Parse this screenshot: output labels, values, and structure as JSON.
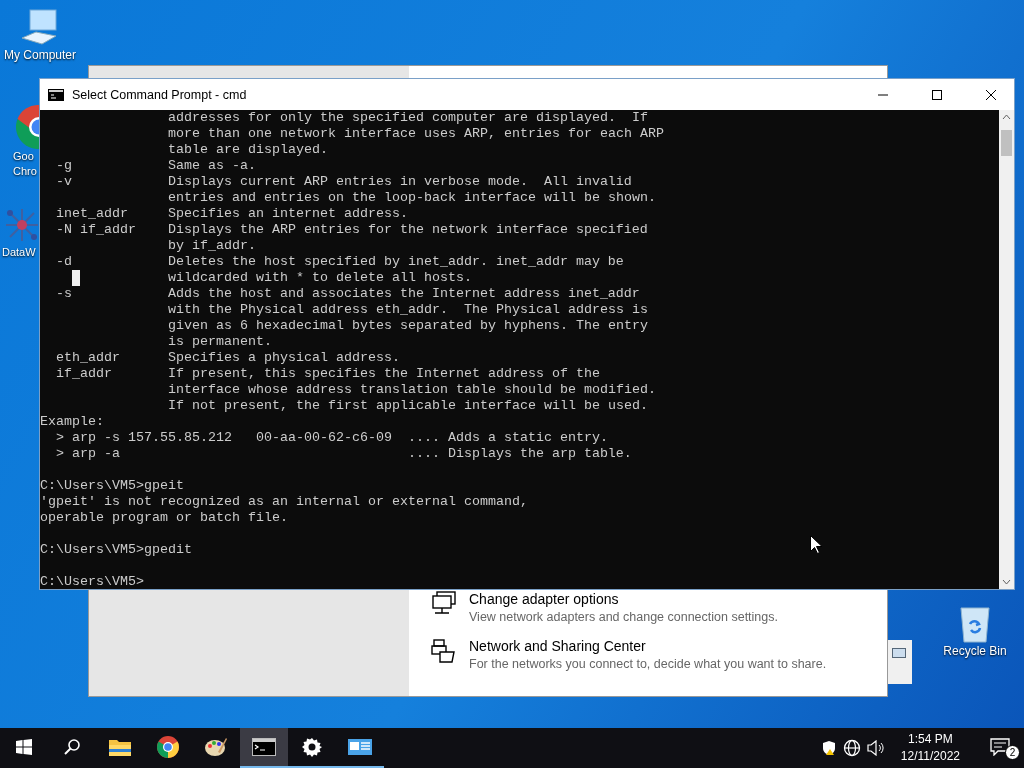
{
  "desktop_icons": [
    {
      "kind": "computer",
      "label": [
        "My Computer"
      ]
    },
    {
      "kind": "chrome",
      "label": [
        "Goo",
        "Chro"
      ]
    },
    {
      "kind": "molecule",
      "label": [
        "DataW"
      ]
    }
  ],
  "recycle_bin": {
    "label": "Recycle Bin"
  },
  "settings_window": {
    "items": [
      {
        "kind": "adapter",
        "title": "Change adapter options",
        "description": "View network adapters and change connection settings."
      },
      {
        "kind": "sharing",
        "title": "Network and Sharing Center",
        "description": "For the networks you connect to, decide what you want to share."
      }
    ]
  },
  "console_window": {
    "title": "Select Command Prompt - cmd",
    "blocks": [
      [
        "                addresses for only the specified computer are displayed.  If",
        "                more than one network interface uses ARP, entries for each ARP",
        "                table are displayed.",
        "  -g            Same as -a.",
        "  -v            Displays current ARP entries in verbose mode.  All invalid",
        "                entries and entries on the loop-back interface will be shown.",
        "  inet_addr     Specifies an internet address.",
        "  -N if_addr    Displays the ARP entries for the network interface specified",
        "                by if_addr.",
        "  -d            Deletes the host specified by inet_addr. inet_addr may be",
        "                wildcarded with * to delete all hosts.",
        "  -s            Adds the host and associates the Internet address inet_addr",
        "                with the Physical address eth_addr.  The Physical address is",
        "                given as 6 hexadecimal bytes separated by hyphens. The entry",
        "                is permanent.",
        "  eth_addr      Specifies a physical address.",
        "  if_addr       If present, this specifies the Internet address of the",
        "                interface whose address translation table should be modified.",
        "                If not present, the first applicable interface will be used.",
        "Example:",
        "  > arp -s 157.55.85.212   00-aa-00-62-c6-09  .... Adds a static entry.",
        "  > arp -a                                    .... Displays the arp table."
      ],
      [
        "C:\\Users\\VM5>gpeit",
        "'gpeit' is not recognized as an internal or external command,",
        "operable program or batch file."
      ],
      [
        "C:\\Users\\VM5>gpedit"
      ],
      [
        "C:\\Users\\VM5>"
      ]
    ]
  },
  "taskbar": {
    "items": [
      {
        "kind": "start",
        "open": false,
        "active": false
      },
      {
        "kind": "search",
        "open": false,
        "active": false
      },
      {
        "kind": "folder",
        "open": false,
        "active": false
      },
      {
        "kind": "chrome",
        "open": false,
        "active": false
      },
      {
        "kind": "paint",
        "open": false,
        "active": false
      },
      {
        "kind": "terminal",
        "open": true,
        "active": true
      },
      {
        "kind": "settings",
        "open": true,
        "active": false
      },
      {
        "kind": "panel",
        "open": true,
        "active": false
      }
    ],
    "time": "1:54 PM",
    "date": "12/11/2022",
    "notification_count": "2"
  }
}
